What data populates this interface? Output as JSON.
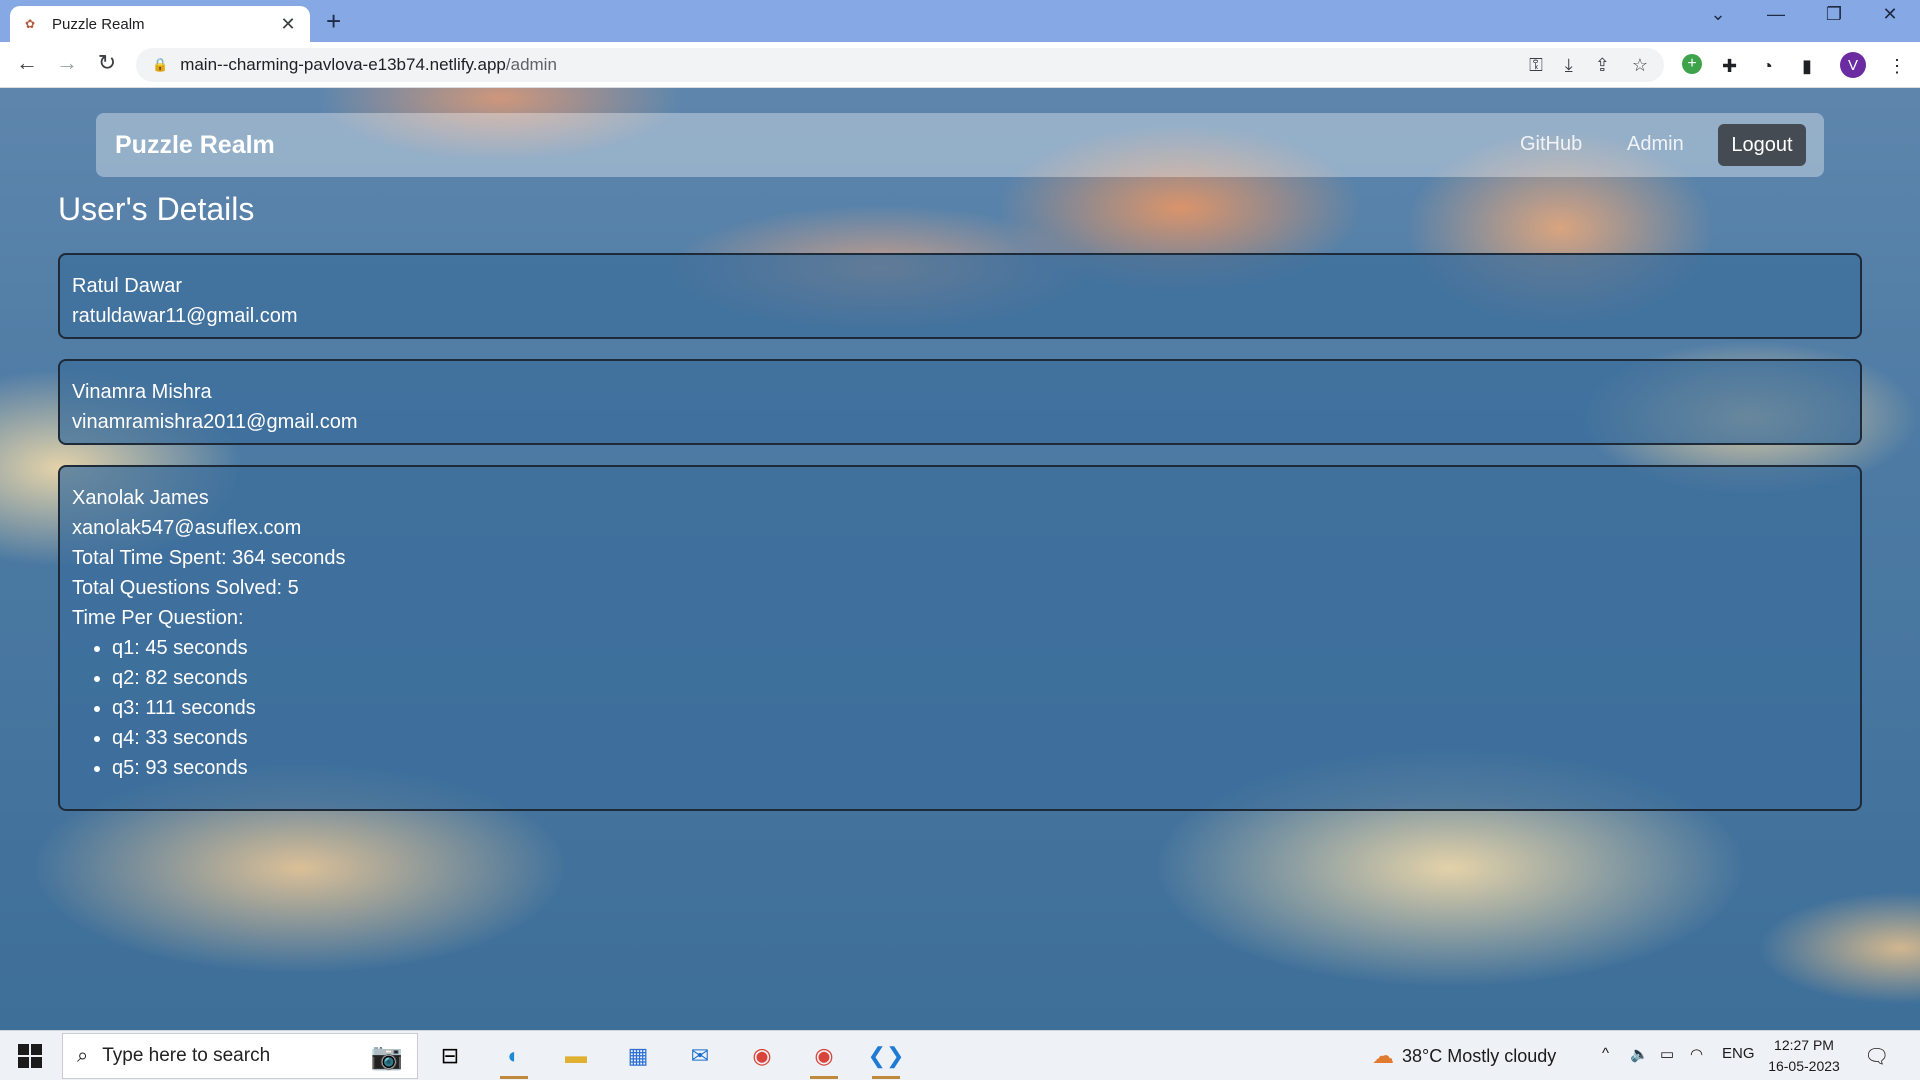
{
  "browser": {
    "tab_title": "Puzzle Realm",
    "url_host": "main--charming-pavlova-e13b74.netlify.app",
    "url_path": "/admin"
  },
  "navbar": {
    "brand": "Puzzle Realm",
    "links": [
      "GitHub",
      "Admin"
    ],
    "logout_label": "Logout"
  },
  "page": {
    "title": "User's Details"
  },
  "users": [
    {
      "name": "Ratul Dawar",
      "email": "ratuldawar11@gmail.com"
    },
    {
      "name": "Vinamra Mishra",
      "email": "vinamramishra2011@gmail.com"
    },
    {
      "name": "Xanolak James",
      "email": "xanolak547@asuflex.com",
      "total_time": "Total Time Spent: 364 seconds",
      "total_solved": "Total Questions Solved: 5",
      "per_question_label": "Time Per Question:",
      "per_question": [
        "q1: 45 seconds",
        "q2: 82 seconds",
        "q3: 111 seconds",
        "q4: 33 seconds",
        "q5: 93 seconds"
      ]
    }
  ],
  "taskbar": {
    "search_placeholder": "Type here to search",
    "weather": "38°C  Mostly cloudy",
    "lang": "ENG",
    "time": "12:27 PM",
    "date": "16-05-2023"
  },
  "icons": {
    "tab_favicon": "puzzle-favicon",
    "profile_initial": "V"
  },
  "colors": {
    "logout_bg": "#454b52",
    "tab_bar": "#86a9e6"
  }
}
